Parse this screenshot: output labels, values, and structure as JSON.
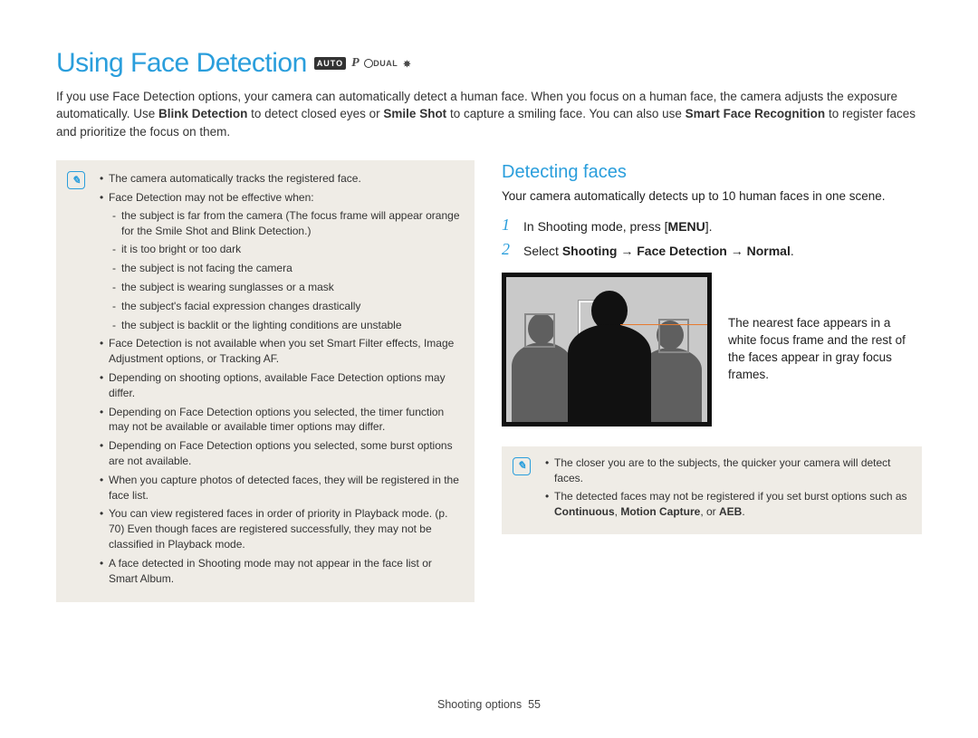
{
  "title": "Using Face Detection",
  "mode_icons": {
    "auto": "AUTO",
    "p": "P",
    "dual": "DUAL",
    "scene": ""
  },
  "intro": {
    "p1a": "If you use Face Detection options, your camera can automatically detect a human face. When you focus on a human face, the camera adjusts the exposure automatically. Use ",
    "b1": "Blink Detection",
    "p1b": " to detect closed eyes or ",
    "b2": "Smile Shot",
    "p1c": " to capture a smiling face. You can also use ",
    "b3": "Smart Face Recognition",
    "p1d": " to register faces and prioritize the focus on them."
  },
  "left_notes": {
    "n1": "The camera automatically tracks the registered face.",
    "n2": "Face Detection may not be effective when:",
    "n2a": "the subject is far from the camera (The focus frame will appear orange for the Smile Shot and Blink Detection.)",
    "n2b": "it is too bright or too dark",
    "n2c": "the subject is not facing the camera",
    "n2d": "the subject is wearing sunglasses or a mask",
    "n2e": "the subject's facial expression changes drastically",
    "n2f": "the subject is backlit or the lighting conditions are unstable",
    "n3": "Face Detection is not available when you set Smart Filter effects, Image Adjustment options, or Tracking AF.",
    "n4": "Depending on shooting options, available Face Detection options may differ.",
    "n5": "Depending on Face Detection options you selected, the timer function may not be available or available timer options may differ.",
    "n6": "Depending on Face Detection options you selected, some burst options are not available.",
    "n7": "When you capture photos of detected faces, they will be registered in the face list.",
    "n8": "You can view registered faces in order of priority in Playback mode. (p. 70) Even though faces are registered successfully, they may not be classified in Playback mode.",
    "n9": "A face detected in Shooting mode may not appear in the face list or Smart Album."
  },
  "section": {
    "title": "Detecting faces",
    "intro": "Your camera automatically detects up to 10 human faces in one scene.",
    "step1_a": "In Shooting mode, press [",
    "step1_key": "MENU",
    "step1_b": "].",
    "step2_a": "Select ",
    "step2_b1": "Shooting",
    "step2_arrow": " → ",
    "step2_b2": "Face Detection",
    "step2_b3": "Normal",
    "step2_end": ".",
    "caption": "The nearest face appears in a white focus frame and the rest of the faces appear in gray focus frames."
  },
  "right_notes": {
    "r1": "The closer you are to the subjects, the quicker your camera will detect faces.",
    "r2a": "The detected faces may not be registered if you set burst options such as ",
    "r2b1": "Continuous",
    "r2sep": ", ",
    "r2b2": "Motion Capture",
    "r2or": ", or ",
    "r2b3": "AEB",
    "r2end": "."
  },
  "footer": {
    "section": "Shooting options",
    "page": "55"
  }
}
